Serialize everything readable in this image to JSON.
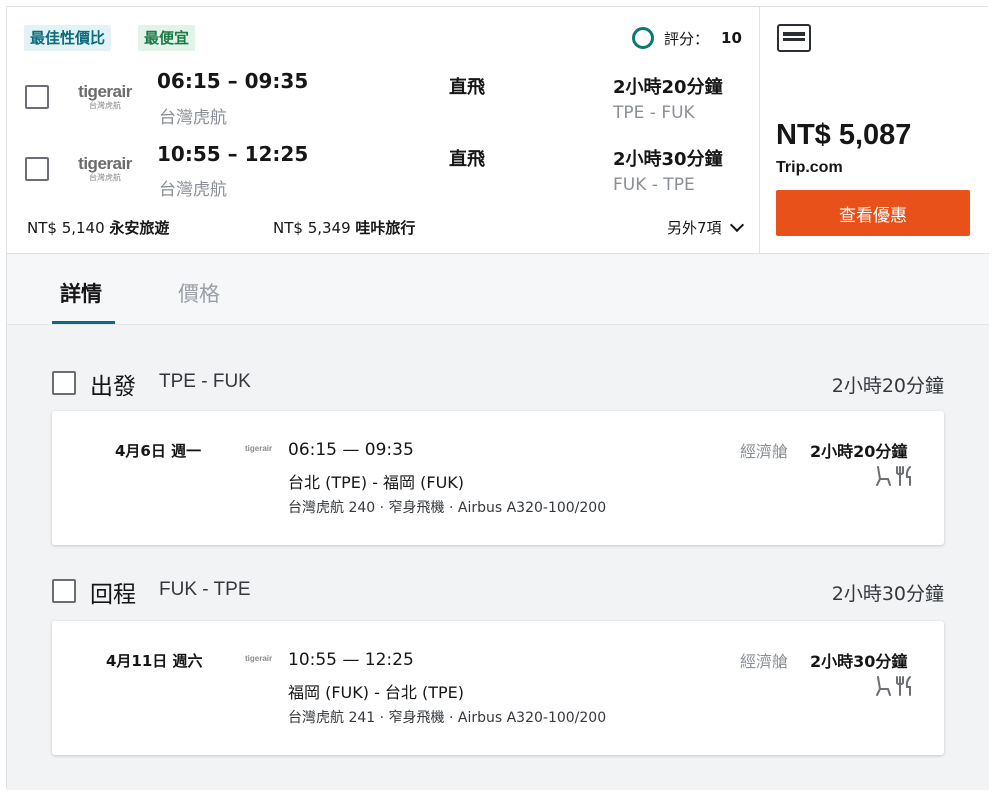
{
  "tags": {
    "best_value": "最佳性價比",
    "cheapest": "最便宜"
  },
  "score": {
    "label": "評分：",
    "value": "10"
  },
  "outbound": {
    "times": "06:15 – 09:35",
    "airline": "台灣虎航",
    "stops": "直飛",
    "duration": "2小時20分鐘",
    "route": "TPE - FUK"
  },
  "inbound": {
    "times": "10:55 – 12:25",
    "airline": "台灣虎航",
    "stops": "直飛",
    "duration": "2小時30分鐘",
    "route": "FUK - TPE"
  },
  "logo": {
    "wordmark": "tigerair",
    "sub": "台灣虎航"
  },
  "alt_prices": [
    {
      "price": "NT$ 5,140",
      "vendor": "永安旅遊"
    },
    {
      "price": "NT$ 5,349",
      "vendor": "哇咔旅行"
    }
  ],
  "more_label": "另外7項",
  "offer": {
    "price": "NT$ 5,087",
    "vendor": "Trip.com",
    "cta": "查看優惠"
  },
  "tabs": {
    "details": "詳情",
    "price": "價格"
  },
  "segments": [
    {
      "title": "出發",
      "route": "TPE - FUK",
      "duration": "2小時20分鐘",
      "date": "4月6日 週一",
      "mini_logo": "tigerair",
      "times": "06:15 — 09:35",
      "cities": "台北 (TPE) - 福岡 (FUK)",
      "meta": "台灣虎航 240 · 窄身飛機 · Airbus A320-100/200",
      "cabin": "經濟艙",
      "leg_duration": "2小時20分鐘"
    },
    {
      "title": "回程",
      "route": "FUK - TPE",
      "duration": "2小時30分鐘",
      "date": "4月11日 週六",
      "mini_logo": "tigerair",
      "times": "10:55 — 12:25",
      "cities": "福岡 (FUK) - 台北 (TPE)",
      "meta": "台灣虎航 241 · 窄身飛機 · Airbus A320-100/200",
      "cabin": "經濟艙",
      "leg_duration": "2小時30分鐘"
    }
  ],
  "colors": {
    "accent": "#0b6b7c",
    "cta": "#e8511a",
    "score_ring": "#0b7a6c"
  }
}
